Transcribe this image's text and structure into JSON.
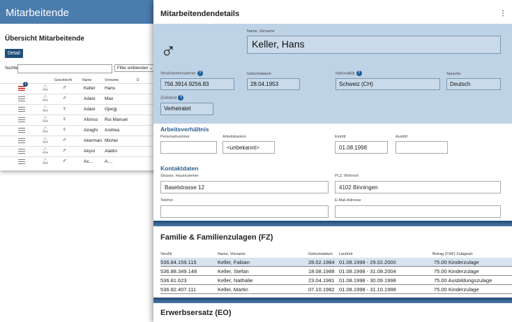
{
  "list": {
    "title": "Mitarbeitende",
    "subtitle": "Übersicht Mitarbeitende",
    "detail_button": "Detail",
    "search_label": "Suchtext",
    "filter_button": "Filter einblenden",
    "columns": [
      "Geschlecht",
      "Name",
      "Vorname",
      "D"
    ],
    "badge": "1",
    "rows": [
      {
        "gender": "♂",
        "name": "Keller",
        "vorname": "Hans"
      },
      {
        "gender": "♂",
        "name": "Adani",
        "vorname": "Max"
      },
      {
        "gender": "♀",
        "name": "Adani",
        "vorname": "Gjergj"
      },
      {
        "gender": "♀",
        "name": "Afonso",
        "vorname": "Rui Manuel"
      },
      {
        "gender": "♀",
        "name": "Airaghi",
        "vorname": "Andrea"
      },
      {
        "gender": "♂",
        "name": "Akerman",
        "vorname": "Michel"
      },
      {
        "gender": "♂",
        "name": "Akyol",
        "vorname": "Alattin"
      },
      {
        "gender": "♂",
        "name": "Ac...",
        "vorname": "A...."
      }
    ]
  },
  "details": {
    "title": "Mitarbeitendendetails",
    "gender_symbol": "♂",
    "name_label": "Name, Vorname",
    "name_value": "Keller, Hans",
    "vn_label": "Versichertennummer",
    "vn_value": "756.3914.9256.83",
    "birth_label": "Geburtsdatum",
    "birth_value": "28.04.1953",
    "nat_label": "Nationalität",
    "nat_value": "Schweiz (CH)",
    "lang_label": "Sprache",
    "lang_value": "Deutsch",
    "civil_label": "Zivilstand",
    "civil_value": "Verheiratet",
    "help_glyph": "?",
    "menu_glyph": "⋮"
  },
  "employment": {
    "title": "Arbeitsverhältnis",
    "pers_label": "Personalnummer",
    "pers_value": "",
    "canton_label": "Arbeitskanton",
    "canton_value": "<unbekannt>",
    "entry_label": "Eintritt",
    "entry_value": "01.08.1998",
    "exit_label": "Austritt",
    "exit_value": ""
  },
  "contact": {
    "title": "Kontaktdaten",
    "street_label": "Strasse, Hausnummer",
    "street_value": "Baselstrasse 12",
    "plz_label": "PLZ, Wohnort",
    "plz_value": "4102 Binningen",
    "phone_label": "Telefon",
    "phone_value": "",
    "email_label": "E-Mail-Adresse",
    "email_value": ""
  },
  "family": {
    "title": "Familie & Familienzulagen (FZ)",
    "columns": [
      "VersNr",
      "Name, Vorname",
      "Geburtsdatum",
      "Laufzeit",
      "Betrag (CHF) Zulageart"
    ],
    "rows": [
      {
        "nr": "536.84.159.115",
        "name": "Keller, Fabian",
        "birth": "28.02.1984",
        "period": "01.08.1998 - 29.02.2000",
        "amount": "75.00 Kinderzulage"
      },
      {
        "nr": "536.88.349.148",
        "name": "Keller, Stefan",
        "birth": "18.08.1988",
        "period": "01.08.1998 - 31.08.2004",
        "amount": "75.00 Kinderzulage"
      },
      {
        "nr": "536.81.623",
        "name": "Keller, Nathalie",
        "birth": "23.04.1981",
        "period": "01.08.1998 - 30.09.1998",
        "amount": "75.00 Ausbildungszulage"
      },
      {
        "nr": "536.82.407.111",
        "name": "Keller, Martin",
        "birth": "07.10.1982",
        "period": "01.08.1998 - 31.10.1998",
        "amount": "75.00 Kinderzulage"
      }
    ]
  },
  "eo": {
    "title": "Erwerbsersatz (EO)"
  },
  "colors": {
    "header_blue": "#4a7cae",
    "section_blue": "#bfd3e6",
    "accent": "#1f4e7a"
  }
}
